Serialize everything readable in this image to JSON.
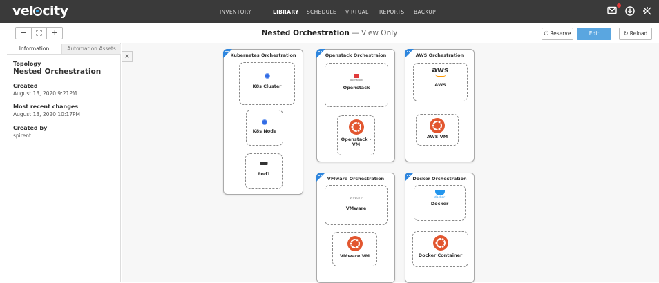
{
  "app": {
    "logo_pre": "vel",
    "logo_post": "city"
  },
  "nav": [
    "INVENTORY",
    "LIBRARY",
    "SCHEDULE",
    "VIRTUAL",
    "REPORTS",
    "BACKUP"
  ],
  "nav_active": "LIBRARY",
  "toolbar": {
    "zoom_out": "−",
    "fit": "⛶",
    "zoom_in": "+",
    "title": "Nested Orchestration",
    "mode": "— View Only",
    "reserve": "Reserve",
    "edit": "Edit",
    "reload": "Reload"
  },
  "sidebar": {
    "tabs": [
      "Information",
      "Automation Assets"
    ],
    "close": "×",
    "topology_label": "Topology",
    "topology_value": "Nested Orchestration",
    "created_label": "Created",
    "created_value": "August 13, 2020 9:21PM",
    "changes_label": "Most recent changes",
    "changes_value": "August 13, 2020 10:17PM",
    "createdby_label": "Created by",
    "createdby_value": "spirent"
  },
  "containers": {
    "k8s": {
      "title": "Kubernetes Orchestration",
      "n1": "K8s Cluster",
      "n2": "K8s Node",
      "n3": "Pod1"
    },
    "os": {
      "title": "Openstack Orchestraion",
      "logo": "openstack",
      "n1": "Openstack",
      "n2a": "Openstack -",
      "n2b": "VM"
    },
    "aws": {
      "title": "AWS Orchestration",
      "logo": "aws",
      "n1": "AWS",
      "n2": "AWS VM"
    },
    "vmw": {
      "title": "VMware Orchestration",
      "logo": "vmware",
      "n1": "VMware",
      "n2": "VMware VM"
    },
    "docker": {
      "title": "Docker Orchestration",
      "logo": "docker",
      "n1": "Docker",
      "n2": "Docker Container"
    }
  },
  "colors": {
    "accent": "#2e86de",
    "topbar": "#3a3a3a",
    "ubuntu": "#e2562f",
    "edit": "#5aa6e0"
  },
  "icons": [
    "mail-icon",
    "download-icon",
    "settings-icon",
    "refresh-icon",
    "power-icon"
  ]
}
